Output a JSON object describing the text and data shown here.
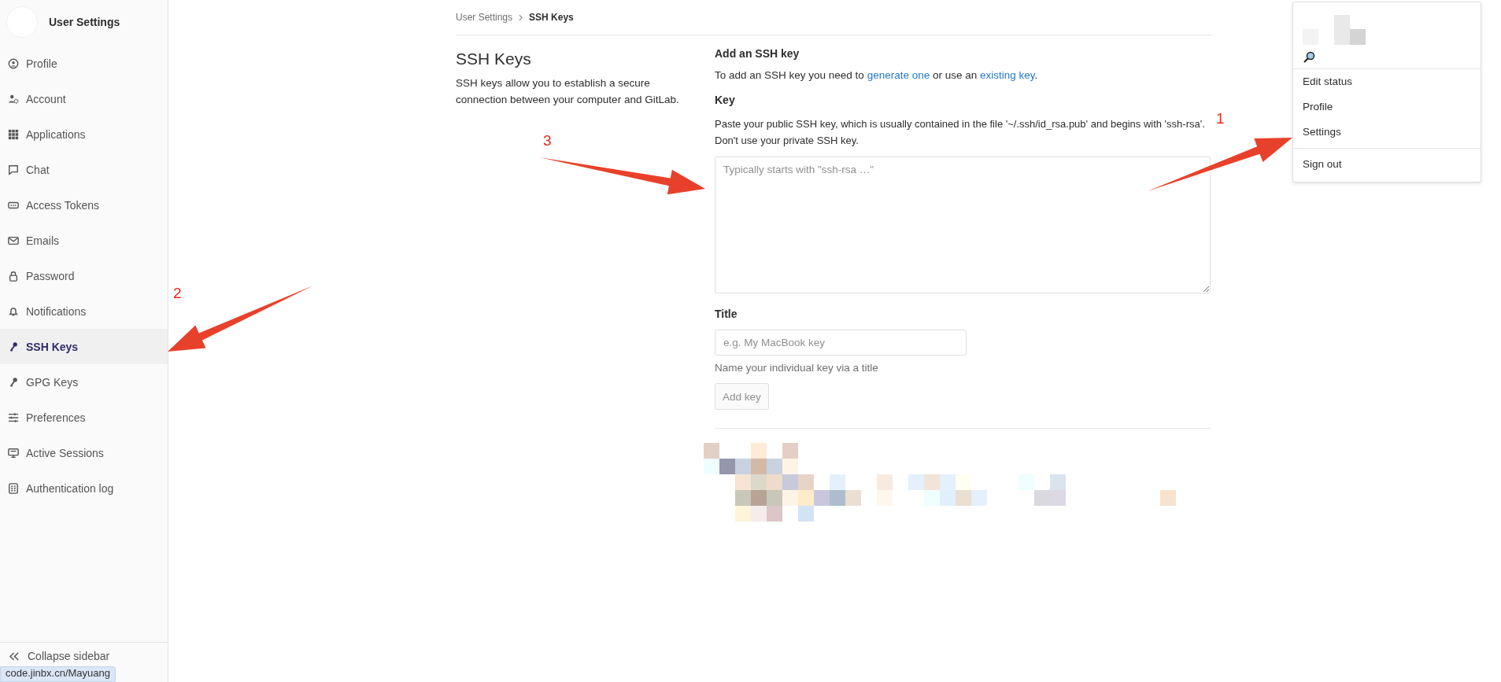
{
  "sidebar": {
    "title": "User Settings",
    "items": [
      {
        "label": "Profile",
        "selected": false
      },
      {
        "label": "Account",
        "selected": false
      },
      {
        "label": "Applications",
        "selected": false
      },
      {
        "label": "Chat",
        "selected": false
      },
      {
        "label": "Access Tokens",
        "selected": false
      },
      {
        "label": "Emails",
        "selected": false
      },
      {
        "label": "Password",
        "selected": false
      },
      {
        "label": "Notifications",
        "selected": false
      },
      {
        "label": "SSH Keys",
        "selected": true
      },
      {
        "label": "GPG Keys",
        "selected": false
      },
      {
        "label": "Preferences",
        "selected": false
      },
      {
        "label": "Active Sessions",
        "selected": false
      },
      {
        "label": "Authentication log",
        "selected": false
      }
    ],
    "collapse": "Collapse sidebar"
  },
  "status_url": "code.jinbx.cn/Mayuang",
  "breadcrumb": [
    {
      "label": "User Settings",
      "current": false
    },
    {
      "label": "SSH Keys",
      "current": true
    }
  ],
  "intro": {
    "title": "SSH Keys",
    "text": "SSH keys allow you to establish a secure connection between your computer and GitLab."
  },
  "form": {
    "heading": "Add an SSH key",
    "lead": [
      "To add an SSH key you need to ",
      "generate one",
      " or use an ",
      "existing key",
      "."
    ],
    "key_label": "Key",
    "key_help": "Paste your public SSH key, which is usually contained in the file '~/.ssh/id_rsa.pub' and begins with 'ssh-rsa'. Don't use your private SSH key.",
    "key_placeholder": "Typically starts with \"ssh-rsa …\"",
    "title_label": "Title",
    "title_placeholder": "e.g. My MacBook key",
    "title_help": "Name your individual key via a title",
    "submit": "Add key",
    "submit_disabled": true
  },
  "user_menu": {
    "items": [
      {
        "label": "Edit status",
        "divider_before": false
      },
      {
        "label": "Profile",
        "divider_before": false
      },
      {
        "label": "Settings",
        "divider_before": false
      },
      {
        "label": "Sign out",
        "divider_before": true
      }
    ]
  },
  "annotations": [
    {
      "label": "1"
    },
    {
      "label": "2"
    },
    {
      "label": "3"
    }
  ]
}
